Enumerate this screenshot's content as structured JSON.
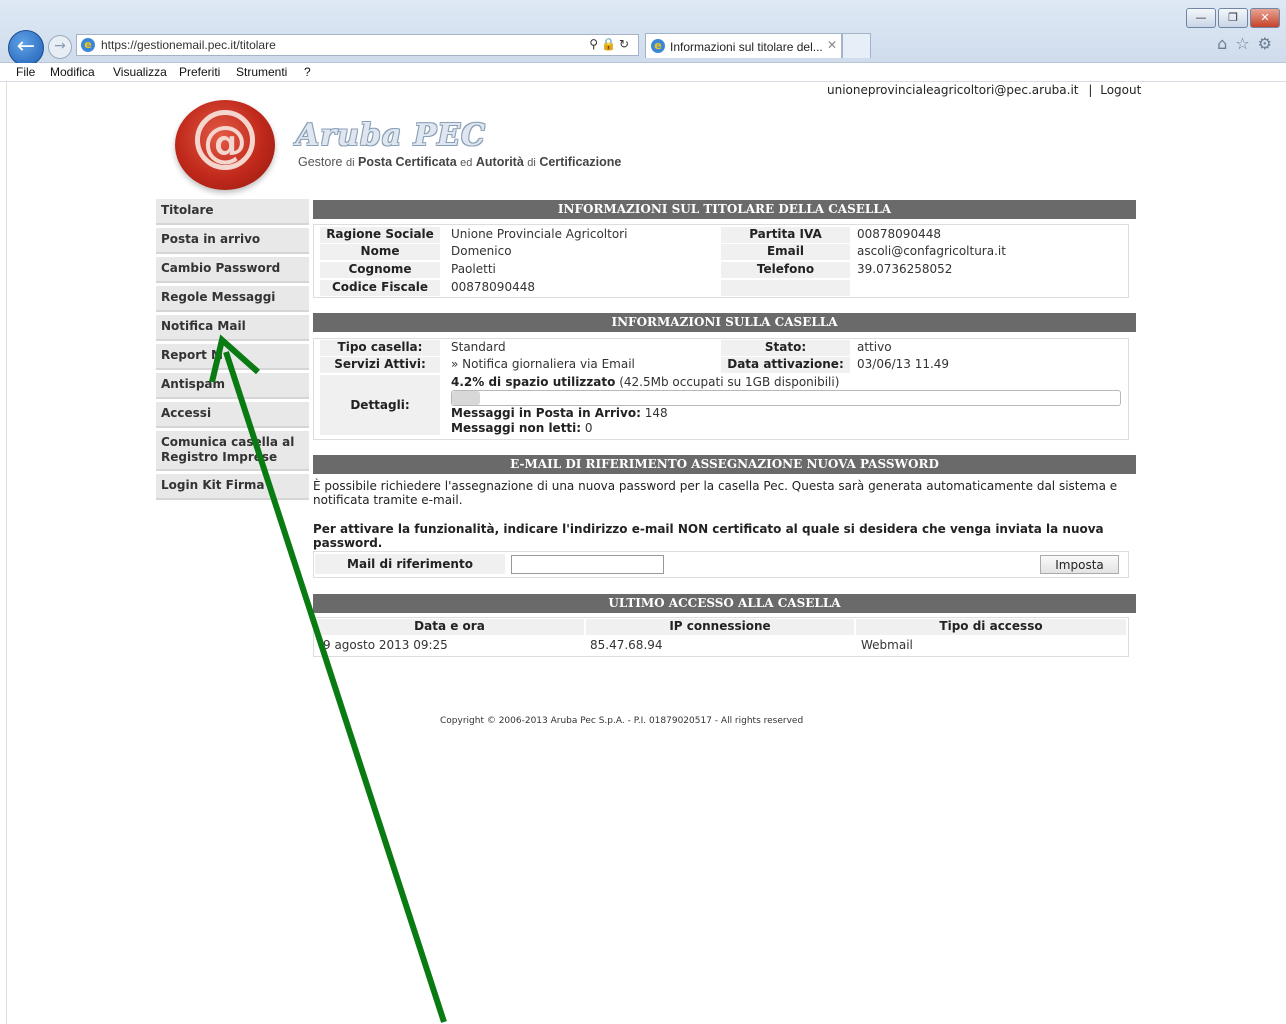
{
  "window": {
    "controls": [
      "—",
      "❐",
      "✕"
    ]
  },
  "browser": {
    "url": "https://gestionemail.pec.it/titolare",
    "tab_title": "Informazioni sul titolare del...",
    "menu": [
      "File",
      "Modifica",
      "Visualizza",
      "Preferiti",
      "Strumenti",
      "?"
    ]
  },
  "header": {
    "user_email": "unioneprovincialeagricoltori@pec.aruba.it",
    "separator": "|",
    "logout": "Logout",
    "brand": "Aruba PEC",
    "tagline_parts": [
      "Gestore",
      "di",
      "Posta Certificata",
      "ed",
      "Autorità",
      "di",
      "Certificazione"
    ]
  },
  "sidebar": {
    "items": [
      {
        "label": "Titolare"
      },
      {
        "label": "Posta in arrivo"
      },
      {
        "label": "Cambio Password"
      },
      {
        "label": "Regole Messaggi"
      },
      {
        "label": "Notifica Mail"
      },
      {
        "label": "Report M"
      },
      {
        "label": "Antispam"
      },
      {
        "label": "Accessi"
      },
      {
        "label": "Comunica casella al Registro Imprese"
      },
      {
        "label": "Login Kit Firma"
      }
    ]
  },
  "titolare": {
    "header": "INFORMAZIONI SUL TITOLARE DELLA CASELLA",
    "ragione_sociale_label": "Ragione Sociale",
    "ragione_sociale": "Unione Provinciale Agricoltori",
    "nome_label": "Nome",
    "nome": "Domenico",
    "cognome_label": "Cognome",
    "cognome": "Paoletti",
    "cf_label": "Codice Fiscale",
    "cf": "00878090448",
    "piva_label": "Partita IVA",
    "piva": "00878090448",
    "email_label": "Email",
    "email": "ascoli@confagricoltura.it",
    "telefono_label": "Telefono",
    "telefono": "39.0736258052"
  },
  "casella": {
    "header": "INFORMAZIONI SULLA CASELLA",
    "tipo_label": "Tipo casella:",
    "tipo": "Standard",
    "servizi_label": "Servizi Attivi:",
    "servizi": "» Notifica giornaliera via Email",
    "stato_label": "Stato:",
    "stato": "attivo",
    "attivazione_label": "Data attivazione:",
    "attivazione": "03/06/13 11.49",
    "dettagli_label": "Dettagli:",
    "spazio_bold": "4.2% di spazio utilizzato",
    "spazio_rest": "(42.5Mb occupati su 1GB disponibili)",
    "usage_fraction": 0.042,
    "arrivo_label": "Messaggi in Posta in Arrivo:",
    "arrivo": "148",
    "nonletti_label": "Messaggi non letti:",
    "nonletti": "0"
  },
  "riferimento": {
    "header": "E-MAIL DI RIFERIMENTO ASSEGNAZIONE NUOVA PASSWORD",
    "info": "È possibile richiedere l'assegnazione di una nuova password per la casella Pec. Questa sarà generata automaticamente dal sistema e notificata tramite e-mail.",
    "instruction": "Per attivare la funzionalità, indicare l'indirizzo e-mail NON certificato al quale si desidera che venga inviata la nuova password.",
    "field_label": "Mail di riferimento",
    "field_value": "",
    "button": "Imposta"
  },
  "accesso": {
    "header": "ULTIMO ACCESSO ALLA CASELLA",
    "columns": [
      "Data e ora",
      "IP connessione",
      "Tipo di accesso"
    ],
    "row": [
      "9 agosto 2013 09:25",
      "85.47.68.94",
      "Webmail"
    ]
  },
  "footer": {
    "copyright": "Copyright © 2006-2013 Aruba Pec S.p.A. - P.I. 01879020517 - All rights reserved"
  },
  "colors": {
    "section_header": "#6a6a6a",
    "annotation_arrow": "#0a7a12"
  },
  "icons": [
    "back-icon",
    "forward-icon",
    "ie-icon",
    "search-icon",
    "lock-icon",
    "refresh-icon",
    "home-icon",
    "star-icon",
    "gear-icon",
    "seal-logo"
  ]
}
